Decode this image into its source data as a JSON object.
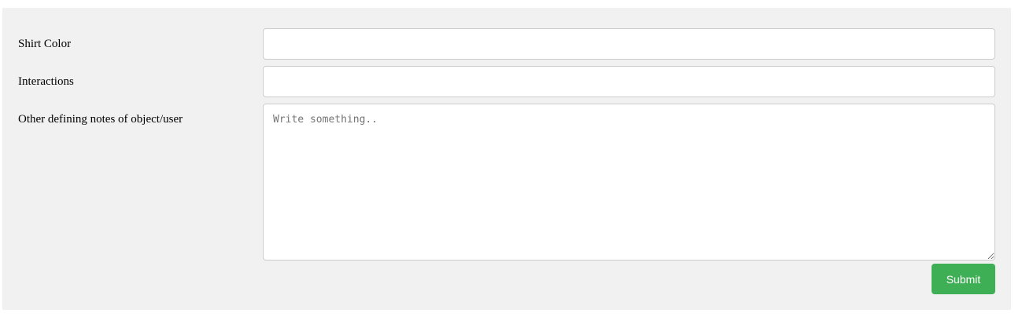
{
  "form": {
    "shirt_color": {
      "label": "Shirt Color",
      "value": ""
    },
    "interactions": {
      "label": "Interactions",
      "value": ""
    },
    "notes": {
      "label": "Other defining notes of object/user",
      "placeholder": "Write something..",
      "value": ""
    },
    "submit_label": "Submit"
  },
  "colors": {
    "panel_background": "#f1f1f1",
    "submit_button": "#3eaf55"
  }
}
